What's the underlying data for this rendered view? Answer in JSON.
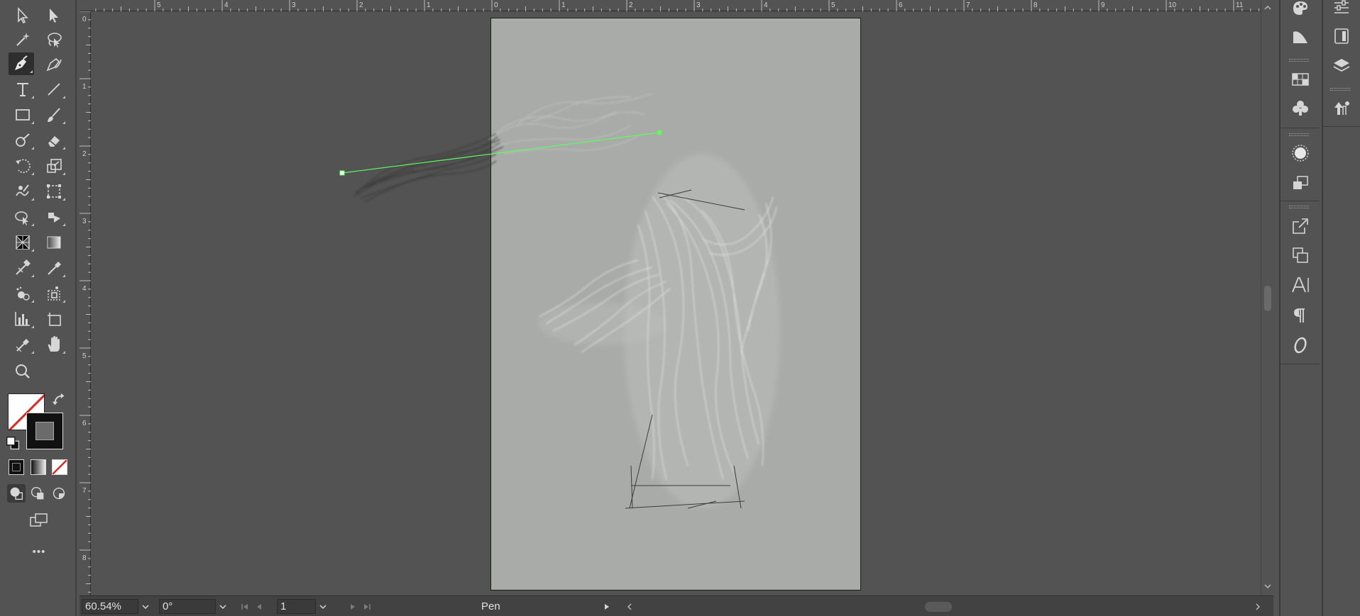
{
  "status_bar": {
    "zoom": "60.54%",
    "rotation": "0°",
    "artboard_number": "1",
    "current_tool": "Pen"
  },
  "rulers": {
    "top": [
      "5",
      "4",
      "3",
      "2",
      "1",
      "0",
      "1",
      "2",
      "3",
      "4",
      "5",
      "6",
      "7",
      "8",
      "9",
      "10",
      "11"
    ],
    "left": [
      "0",
      "1",
      "2",
      "3",
      "4",
      "5",
      "6",
      "7",
      "8"
    ]
  },
  "toolbar": {
    "active_tool": "pen-tool",
    "fill": "none",
    "stroke_color": "#6b6b6b",
    "more_tools_label": "•••"
  },
  "right_panel": {
    "icons": [
      "color-guide-icon",
      "gradient-icon",
      "swatches-icon",
      "symbols-icon",
      "appearance-icon",
      "graphic-styles-icon",
      "export-icon",
      "artboards-icon",
      "character-icon",
      "paragraph-icon",
      "opentype-icon"
    ],
    "icons_secondary": [
      "properties-icon",
      "libraries-icon",
      "layers-icon",
      "asset-export-icon"
    ]
  },
  "colors": {
    "ui_bg": "#535353",
    "artboard": "#a8aba8",
    "path_highlight": "#5cff5c"
  }
}
